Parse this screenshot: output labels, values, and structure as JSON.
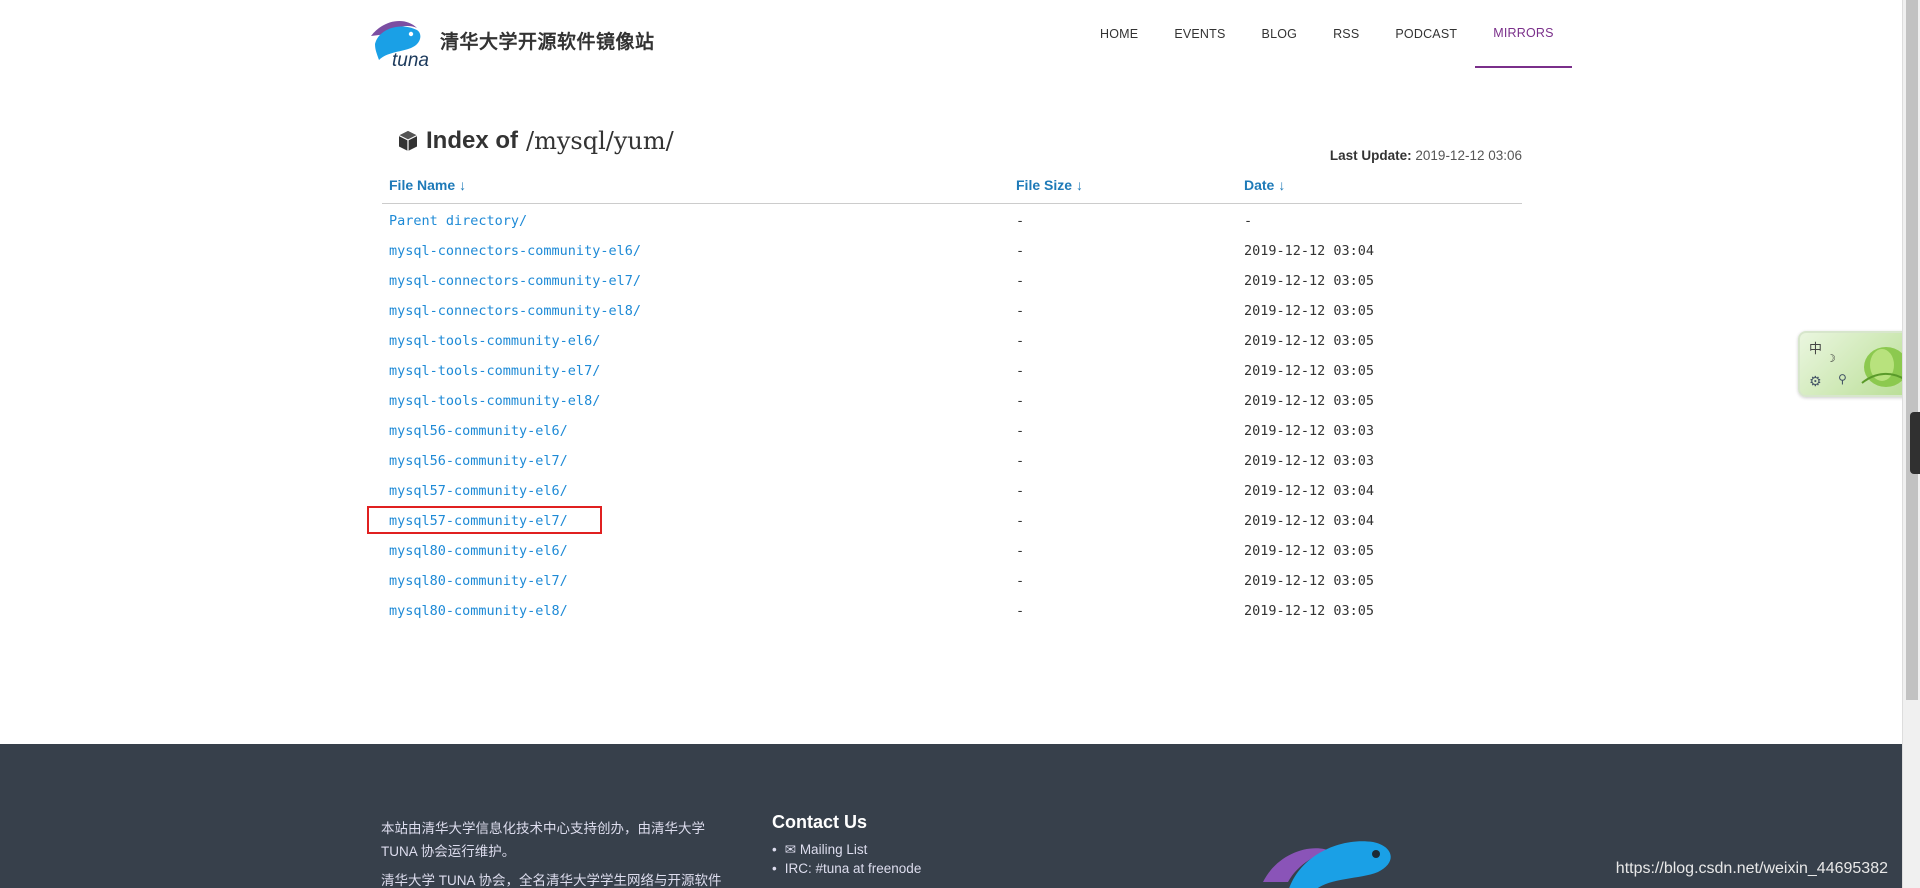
{
  "header": {
    "site_title": "清华大学开源软件镜像站",
    "nav": [
      "HOME",
      "EVENTS",
      "BLOG",
      "RSS",
      "PODCAST",
      "MIRRORS"
    ],
    "active_nav": "MIRRORS"
  },
  "listing": {
    "heading_prefix": "Index of",
    "heading_path": "/mysql/yum/",
    "last_update_label": "Last Update:",
    "last_update_value": "2019-12-12 03:06",
    "columns": {
      "name": "File Name",
      "size": "File Size",
      "date": "Date",
      "sort_arrow": "↓"
    },
    "rows": [
      {
        "name": "Parent directory/",
        "size": "-",
        "date": "-"
      },
      {
        "name": "mysql-connectors-community-el6/",
        "size": "-",
        "date": "2019-12-12 03:04"
      },
      {
        "name": "mysql-connectors-community-el7/",
        "size": "-",
        "date": "2019-12-12 03:05"
      },
      {
        "name": "mysql-connectors-community-el8/",
        "size": "-",
        "date": "2019-12-12 03:05"
      },
      {
        "name": "mysql-tools-community-el6/",
        "size": "-",
        "date": "2019-12-12 03:05"
      },
      {
        "name": "mysql-tools-community-el7/",
        "size": "-",
        "date": "2019-12-12 03:05"
      },
      {
        "name": "mysql-tools-community-el8/",
        "size": "-",
        "date": "2019-12-12 03:05"
      },
      {
        "name": "mysql56-community-el6/",
        "size": "-",
        "date": "2019-12-12 03:03"
      },
      {
        "name": "mysql56-community-el7/",
        "size": "-",
        "date": "2019-12-12 03:03"
      },
      {
        "name": "mysql57-community-el6/",
        "size": "-",
        "date": "2019-12-12 03:04"
      },
      {
        "name": "mysql57-community-el7/",
        "size": "-",
        "date": "2019-12-12 03:04"
      },
      {
        "name": "mysql80-community-el6/",
        "size": "-",
        "date": "2019-12-12 03:05"
      },
      {
        "name": "mysql80-community-el7/",
        "size": "-",
        "date": "2019-12-12 03:05"
      },
      {
        "name": "mysql80-community-el8/",
        "size": "-",
        "date": "2019-12-12 03:05"
      }
    ],
    "highlighted_row": "mysql57-community-el7/"
  },
  "footer": {
    "about_line1": "本站由清华大学信息化技术中心支持创办，由清华大学",
    "about_line2": "TUNA 协会运行维护。",
    "about_line3": "清华大学 TUNA 协会，全名清华大学学生网络与开源软件",
    "contact_title": "Contact Us",
    "contacts": [
      "Mailing List",
      "IRC: #tuna at freenode"
    ],
    "watermark": "https://blog.csdn.net/weixin_44695382"
  },
  "ime": {
    "mode_label": "中"
  },
  "colors": {
    "link": "#1e8ad6",
    "header_link": "#1e7ab8",
    "active_nav": "#7a2f8a",
    "footer_bg": "#37404b",
    "highlight_border": "#e02020"
  },
  "icons": [
    "tuna-logo",
    "box-icon",
    "envelope-icon",
    "gear-icon",
    "moon-icon",
    "pin-icon"
  ]
}
